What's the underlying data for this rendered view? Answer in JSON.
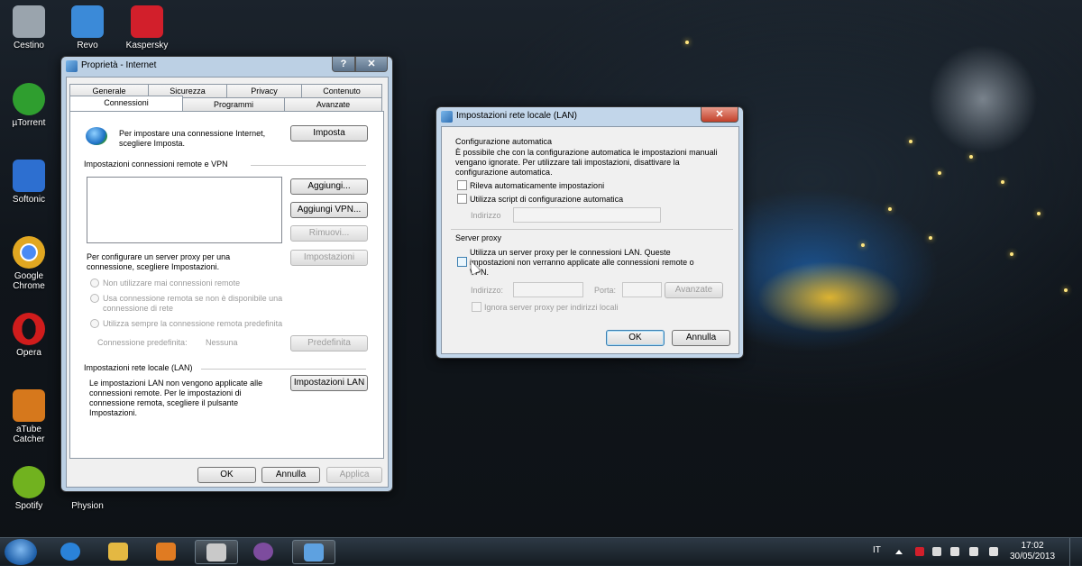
{
  "desktop": {
    "icons": [
      {
        "label": "Cestino",
        "icon": "recycle-bin-icon",
        "color": "#9aa4ad"
      },
      {
        "label": "Revo",
        "icon": "revo-uninstaller-icon",
        "color": "#3b8ad8"
      },
      {
        "label": "Kaspersky",
        "icon": "kaspersky-icon",
        "color": "#d21f2b"
      },
      {
        "label": "µTorrent",
        "icon": "utorrent-icon",
        "color": "#2f9e2f"
      },
      {
        "label": "Softonic",
        "icon": "softonic-icon",
        "color": "#2d6fd0"
      },
      {
        "label": "Google Chrome",
        "icon": "chrome-icon",
        "color": "#e1a721"
      },
      {
        "label": "Opera",
        "icon": "opera-icon",
        "color": "#d01c1c"
      },
      {
        "label": "aTube Catcher",
        "icon": "atube-catcher-icon",
        "color": "#d6781c"
      },
      {
        "label": "Spotify",
        "icon": "spotify-icon",
        "color": "#71b21f"
      },
      {
        "label": "Physion",
        "icon": "physion-icon",
        "color": "#4b5c6b"
      }
    ]
  },
  "internet_props": {
    "title": "Proprietà - Internet",
    "help_label": "?",
    "close_label": "✕",
    "tabs_row1": [
      "Generale",
      "Sicurezza",
      "Privacy",
      "Contenuto"
    ],
    "tabs_row2": [
      "Connessioni",
      "Programmi",
      "Avanzate"
    ],
    "setup_text": "Per impostare una connessione Internet, scegliere Imposta.",
    "setup_button": "Imposta",
    "dialup_section": "Impostazioni connessioni remote e VPN",
    "add_button": "Aggiungi...",
    "add_vpn_button": "Aggiungi VPN...",
    "remove_button": "Rimuovi...",
    "proxy_text": "Per configurare un server proxy per una connessione, scegliere Impostazioni.",
    "settings_button": "Impostazioni",
    "radio_never": "Non utilizzare mai connessioni remote",
    "radio_when_absent": "Usa connessione remota se non è disponibile una connessione di rete",
    "radio_always": "Utilizza sempre la connessione remota predefinita",
    "default_conn_label": "Connessione predefinita:",
    "default_conn_value": "Nessuna",
    "default_button": "Predefinita",
    "lan_section": "Impostazioni rete locale (LAN)",
    "lan_text": "Le impostazioni LAN non vengono applicate alle connessioni remote. Per le impostazioni di connessione remota, scegliere il pulsante Impostazioni.",
    "lan_button": "Impostazioni LAN",
    "ok_button": "OK",
    "cancel_button": "Annulla",
    "apply_button": "Applica"
  },
  "lan_dialog": {
    "title": "Impostazioni rete locale (LAN)",
    "close_label": "✕",
    "auto_section": "Configurazione automatica",
    "auto_text": "È possibile che con la configurazione automatica le impostazioni manuali vengano ignorate. Per utilizzare tali impostazioni, disattivare la configurazione automatica.",
    "detect_label": "Rileva automaticamente impostazioni",
    "script_label": "Utilizza script di configurazione automatica",
    "address_label": "Indirizzo",
    "proxy_section": "Server proxy",
    "proxy_text": "Utilizza un server proxy per le connessioni LAN. Queste impostazioni non verranno applicate alle connessioni remote o VPN.",
    "proxy_address_label": "Indirizzo:",
    "port_label": "Porta:",
    "advanced_button": "Avanzate",
    "bypass_label": "Ignora server proxy per indirizzi locali",
    "ok_button": "OK",
    "cancel_button": "Annulla"
  },
  "taskbar": {
    "apps": [
      {
        "icon": "start-orb-icon",
        "color": "#3d86d6"
      },
      {
        "icon": "internet-explorer-icon",
        "color": "#2a82d8"
      },
      {
        "icon": "windows-explorer-icon",
        "color": "#e4b842"
      },
      {
        "icon": "media-player-icon",
        "color": "#e07b22"
      },
      {
        "icon": "snipping-tool-icon",
        "color": "#c9c9c9"
      },
      {
        "icon": "tor-onion-icon",
        "color": "#7d4c9e"
      },
      {
        "icon": "internet-properties-icon",
        "color": "#5ea1e0"
      }
    ],
    "lang": "IT",
    "time": "17:02",
    "date": "30/05/2013"
  }
}
